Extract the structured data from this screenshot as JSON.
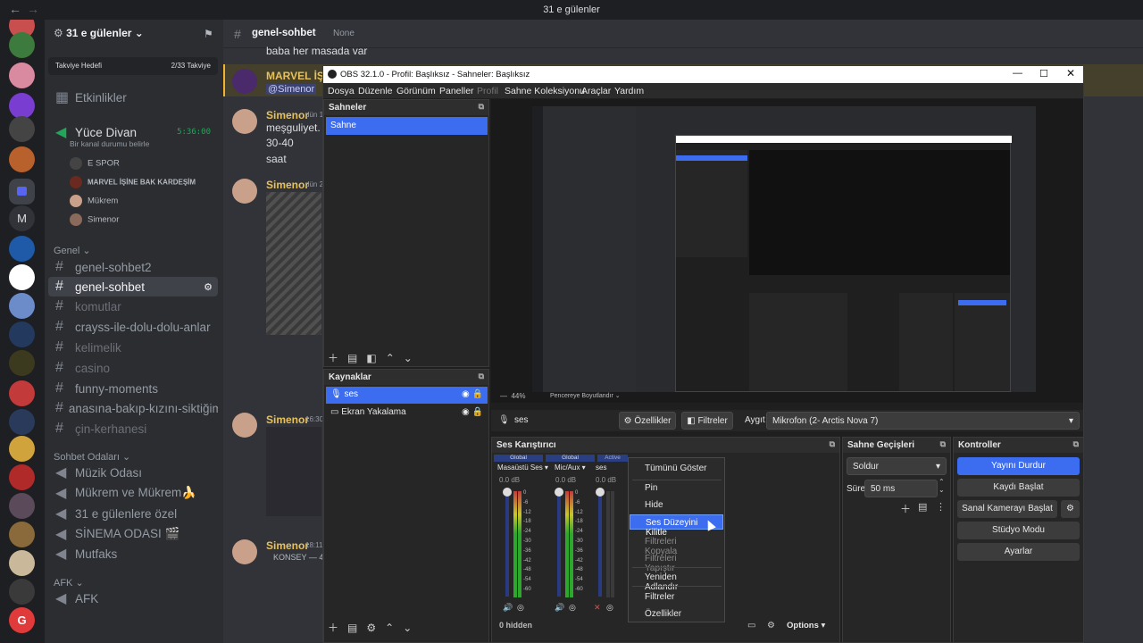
{
  "window": {
    "title": "31 e gülenler",
    "back_glyph": "←",
    "forward_glyph": "→"
  },
  "server": {
    "name": "31 e gülenler",
    "boost_label": "Takviye Hedefi",
    "boost_count": "2/33 Takviye",
    "events": "Etkinlikler"
  },
  "voice_top": {
    "name": "Yüce Divan",
    "status": "Bir kanal durumu belirle",
    "timer": "5:36:00",
    "members": [
      "E SPOR",
      "MARVEL İŞİNE BAK KARDEŞİM",
      "Mükrem",
      "Simenor"
    ]
  },
  "category_general": "Genel",
  "channels": [
    "genel-sohbet2",
    "genel-sohbet",
    "komutlar",
    "crayss-ile-dolu-dolu-anlar",
    "kelimelik",
    "casino",
    "funny-moments",
    "anasına-bakıp-kızını-siktiğimiz-...",
    "çin-kerhanesi"
  ],
  "category_voice": "Sohbet Odaları",
  "voice_channels": [
    "Müzik Odası",
    "Mükrem ve Mükrem🍌",
    "31 e gülenlere özel",
    "SİNEMA ODASI 🎬",
    "Mutfaks"
  ],
  "category_afk": "AFK",
  "afk_channel": "AFK",
  "chat_header": {
    "channel": "genel-sohbet",
    "topic": "None"
  },
  "messages": [
    {
      "text": "baba her masada var"
    },
    {
      "author": "MARVEL İŞİNE",
      "mention": "@Simenor"
    },
    {
      "author": "Simenor",
      "time": "dün 1",
      "lines": [
        "meşguliyet.",
        "30-40",
        "saat"
      ]
    },
    {
      "author": "Simenor",
      "time": "dün 2"
    },
    {
      "author": "Simenor",
      "time": "16:30"
    },
    {
      "author": "Simenor",
      "time": "18:11",
      "line": "KONSEY — 4"
    }
  ],
  "obs": {
    "title": "OBS 32.1.0 - Profil: Başlıksız - Sahneler: Başlıksız",
    "menu": [
      "Dosya",
      "Düzenle",
      "Görünüm",
      "Paneller",
      "Profil",
      "Sahne Koleksiyonu",
      "Araçlar",
      "Yardım"
    ],
    "scenes_title": "Sahneler",
    "scenes": [
      "Sahne"
    ],
    "sources_title": "Kaynaklar",
    "sources": [
      "ses",
      "Ekran Yakalama"
    ],
    "preview_zoom": "44%",
    "preview_mode": "Pencereye Boyutlandır",
    "props_source": "ses",
    "props_button": "Özellikler",
    "filters_button": "Filtreler",
    "device_label": "Aygıt",
    "device_value": "Mikrofon (2- Arctis Nova 7)",
    "mixer_title": "Ses Karıştırıcı",
    "mixer_channels": [
      {
        "tag": "Global",
        "name": "Masaüstü Ses",
        "db": "0.0 dB"
      },
      {
        "tag": "Global",
        "name": "Mic/Aux",
        "db": "0.0 dB"
      },
      {
        "tag": "Active",
        "name": "ses",
        "db": "0.0 dB"
      }
    ],
    "mixer_ticks": [
      "0",
      "-6",
      "-12",
      "-18",
      "-24",
      "-30",
      "-36",
      "-42",
      "-48",
      "-54",
      "-60"
    ],
    "hidden_count": "0 hidden",
    "options_button": "Options",
    "transitions_title": "Sahne Geçişleri",
    "transition_value": "Soldur",
    "duration_label": "Süre",
    "duration_value": "50 ms",
    "controls_title": "Kontroller",
    "controls": [
      "Yayını Durdur",
      "Kaydı Başlat",
      "Sanal Kamerayı Başlat",
      "Stüdyo Modu",
      "Ayarlar"
    ]
  },
  "context_menu": [
    "Tümünü Göster",
    "Pin",
    "Hide",
    "Ses Düzeyini Kilitle",
    "Filtreleri Kopyala",
    "Filtreleri Yapıştır",
    "Yeniden Adlandır",
    "Filtreler",
    "Özellikler"
  ],
  "colors": {
    "accent": "#3c6df0",
    "discord_bg": "#313338",
    "sidebar_bg": "#2b2d31",
    "timer": "#23a55a"
  }
}
